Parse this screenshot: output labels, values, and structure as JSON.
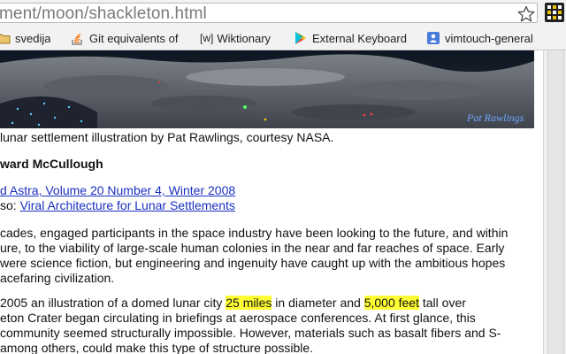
{
  "browser": {
    "address": "ment/moon/shackleton.html",
    "bookmarks": [
      {
        "label": "svedija",
        "icon": "folder-icon"
      },
      {
        "label": "Git equivalents of",
        "icon": "stackoverflow-icon"
      },
      {
        "label": "Wiktionary",
        "icon": "wiktionary-icon",
        "prefix": "[w]"
      },
      {
        "label": "External Keyboard",
        "icon": "play-store-icon"
      },
      {
        "label": "vimtouch-general",
        "icon": "google-groups-icon"
      }
    ]
  },
  "hero": {
    "signature": "Pat Rawlings"
  },
  "article": {
    "caption": "lunar settlement illustration by Pat Rawlings, courtesy NASA.",
    "author": "ward McCullough",
    "source_link": "d Astra, Volume 20 Number 4, Winter 2008",
    "see_also_prefix": "so: ",
    "see_also_link": "Viral Architecture for Lunar Settlements",
    "p1": [
      "cades, engaged participants in the space industry have been looking to the future, and within",
      "ure, to the viability of large-scale human colonies in the near and far reaches of space. Early",
      "were science fiction, but engineering and ingenuity have caught up with the ambitious hopes",
      "acefaring civilization."
    ],
    "p2_l1_a": " 2005 an illustration of a domed lunar city ",
    "p2_hl1": "25 miles",
    "p2_l1_b": " in diameter and ",
    "p2_hl2": "5,000 feet",
    "p2_l1_c": " tall over",
    "p2_l2": "eton Crater began circulating in briefings at aerospace conferences. At first glance, this",
    "p2_l3": " community seemed structurally impossible. However, materials such as basalt fibers and S-",
    "p2_l4": "among others, could make this type of structure possible."
  }
}
